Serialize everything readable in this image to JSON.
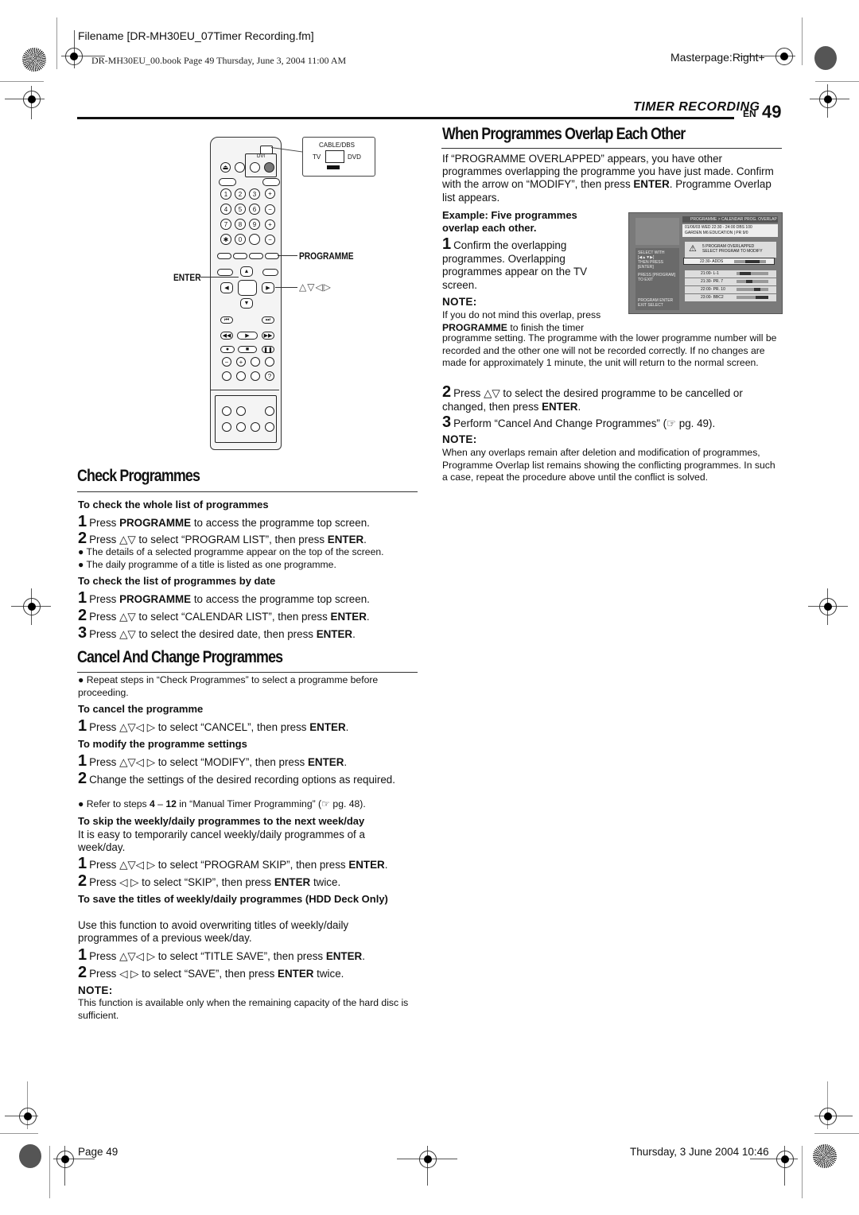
{
  "print_header": {
    "filename": "Filename [DR-MH30EU_07Timer Recording.fm]",
    "book_info": "DR-MH30EU_00.book  Page 49  Thursday, June 3, 2004  11:00 AM",
    "masterpage": "Masterpage:Right+"
  },
  "section": {
    "title": "TIMER RECORDING",
    "lang": "EN",
    "page_number": "49"
  },
  "remote_figure": {
    "switch_label": "CABLE/DBS",
    "switch_left": "TV",
    "switch_right": "DVD",
    "dvi_label": "DVI",
    "number_keys": [
      "1",
      "2",
      "3",
      "4",
      "5",
      "6",
      "7",
      "8",
      "9",
      "✱",
      "0",
      ""
    ],
    "callout_programme": "PROGRAMME",
    "callout_enter": "ENTER",
    "callout_arrows": "△▽◁▷"
  },
  "overlap": {
    "title": "When Programmes Overlap Each Other",
    "intro_1": "If “PROGRAMME OVERLAPPED” appears, you have other programmes overlapping the programme you have just made. Confirm with the arrow on “MODIFY”, then press ",
    "intro_enter": "ENTER",
    "intro_2": ". Programme Overlap list appears.",
    "example_heading": "Example: Five programmes overlap each other.",
    "step1_num": "1",
    "step1_text": "Confirm the overlapping programmes. Overlapping programmes appear on the TV screen.",
    "note_label": "NOTE:",
    "note1_a": "If you do not mind this overlap, press ",
    "note1_b": "PROGRAMME",
    "note1_c": " to finish the timer",
    "note1_cont": "programme setting. The programme with the lower programme number will be recorded and the other one will not be recorded correctly. If no changes are made for approximately 1 minute, the unit will return to the normal screen.",
    "step2_num": "2",
    "step2_a": "Press △▽ to select the desired programme to be cancelled or changed, then press ",
    "step2_b": "ENTER",
    "step2_c": ".",
    "step3_num": "3",
    "step3_text": "Perform “Cancel And Change Programmes” (☞ pg. 49).",
    "note2_label": "NOTE:",
    "note2_text": "When any overlaps remain after deletion and modification of programmes, Programme Overlap list remains showing the conflicting programmes. In such a case, repeat the procedure above until the conflict is solved."
  },
  "tv_screen": {
    "header": "PROGRAMME > CALENDAR PROG.  OVERLAP",
    "info_line1": "01/06/03 WED  22:30 - 24:00        DBS 100",
    "info_line2": "GARDEN M6            EDUCATION | PR 9/0",
    "warning_1": "5 PROGRAM OVERLAPPED",
    "warning_2": "SELECT PROGRAM TO MODIFY",
    "side_1": "SELECT WITH [◀▲▼▶]",
    "side_2": "THEN PRESS [ENTER]",
    "side_3": "PRESS [PROGRAM]",
    "side_4": "TO EXIT",
    "side_5": "PROGRAM    ENTER",
    "side_6": "EXIT       SELECT",
    "rows": [
      {
        "label": "22:30-  ADDS",
        "fill_start": 0.35,
        "fill_end": 0.8
      },
      {
        "label": "21:00-  L-1",
        "fill_start": 0.1,
        "fill_end": 0.45
      },
      {
        "label": "21:30-  PR. 7",
        "fill_start": 0.3,
        "fill_end": 0.5
      },
      {
        "label": "22:00-  PR. 10",
        "fill_start": 0.55,
        "fill_end": 0.75
      },
      {
        "label": "23:00-  BBC2",
        "fill_start": 0.6,
        "fill_end": 1.0
      }
    ]
  },
  "check": {
    "title": "Check Programmes",
    "whole_heading": "To check the whole list of programmes",
    "whole_steps": [
      {
        "num": "1",
        "a": "Press ",
        "b": "PROGRAMME",
        "c": " to access the programme top screen.",
        "d": "",
        "e": ""
      },
      {
        "num": "2",
        "a": "Press △▽ to select “PROGRAM LIST”, then press ",
        "b": "ENTER",
        "c": ".",
        "d": "",
        "e": ""
      }
    ],
    "whole_bullets": [
      "The details of a selected programme appear on the top of the screen.",
      "The daily programme of a title is listed as one programme."
    ],
    "date_heading": "To check the list of programmes by date",
    "date_steps": [
      {
        "num": "1",
        "a": "Press ",
        "b": "PROGRAMME",
        "c": " to access the programme top screen."
      },
      {
        "num": "2",
        "a": "Press △▽ to select “CALENDAR LIST”, then press ",
        "b": "ENTER",
        "c": "."
      },
      {
        "num": "3",
        "a": "Press △▽ to select the desired date, then press ",
        "b": "ENTER",
        "c": "."
      }
    ]
  },
  "cancel": {
    "title": "Cancel And Change Programmes",
    "intro_bullet": "Repeat steps in “Check Programmes” to select a programme before proceeding.",
    "cancel_heading": "To cancel the programme",
    "cancel_step": {
      "num": "1",
      "a": "Press △▽◁ ▷ to select “CANCEL”, then press ",
      "b": "ENTER",
      "c": "."
    },
    "modify_heading": "To modify the programme settings",
    "modify_step1": {
      "num": "1",
      "a": "Press △▽◁ ▷ to select “MODIFY”, then press ",
      "b": "ENTER",
      "c": "."
    },
    "modify_step2": {
      "num": "2",
      "text": "Change the settings of the desired recording options as required."
    },
    "modify_bullet_a": "Refer to steps ",
    "modify_bullet_b": "4",
    "modify_bullet_c": " – ",
    "modify_bullet_d": "12",
    "modify_bullet_e": " in “Manual Timer Programming” (☞ pg. 48).",
    "skip_heading": "To skip the weekly/daily programmes to the next week/day",
    "skip_intro": "It is easy to temporarily cancel weekly/daily programmes of a week/day.",
    "skip_step1": {
      "num": "1",
      "a": "Press △▽◁ ▷ to select “PROGRAM SKIP”, then press ",
      "b": "ENTER",
      "c": "."
    },
    "skip_step2": {
      "num": "2",
      "a": "Press ◁ ▷ to select “SKIP”, then press ",
      "b": "ENTER",
      "c": " twice."
    },
    "save_heading": "To save the titles of weekly/daily programmes (HDD Deck Only)",
    "save_intro": "Use this function to avoid overwriting titles of weekly/daily programmes of a previous week/day.",
    "save_step1": {
      "num": "1",
      "a": "Press △▽◁ ▷ to select “TITLE SAVE”, then press ",
      "b": "ENTER",
      "c": "."
    },
    "save_step2": {
      "num": "2",
      "a": "Press ◁ ▷ to select “SAVE”, then press ",
      "b": "ENTER",
      "c": " twice."
    },
    "note_label": "NOTE:",
    "note_text": "This function is available only when the remaining capacity of the hard disc is sufficient."
  },
  "print_footer": {
    "page": "Page 49",
    "date": "Thursday, 3 June 2004  10:46"
  }
}
